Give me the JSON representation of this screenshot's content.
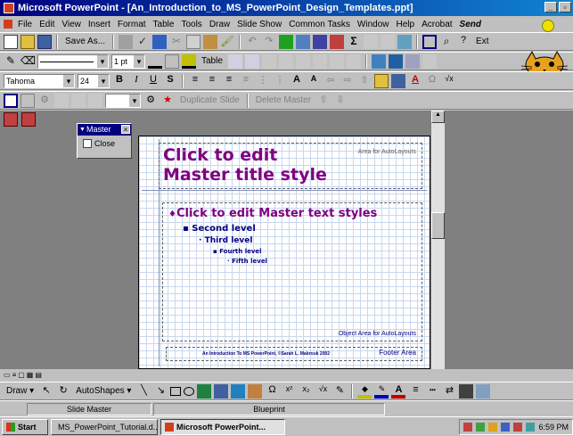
{
  "window": {
    "title": "Microsoft PowerPoint - [An_Introduction_to_MS_PowerPoint_Design_Templates.ppt]"
  },
  "menu": [
    "File",
    "Edit",
    "View",
    "Insert",
    "Format",
    "Table",
    "Tools",
    "Draw",
    "Slide Show",
    "Common Tasks",
    "Window",
    "Help",
    "Acrobat",
    "Send"
  ],
  "toolbar1": {
    "save_as": "Save As...",
    "table": "Table"
  },
  "toolbar2": {
    "line_weight": "1 pt",
    "table": "Table"
  },
  "formatting": {
    "font": "Tahoma",
    "size": "24"
  },
  "master_toolbar": {
    "duplicate_slide": "Duplicate Slide",
    "delete_master": "Delete Master"
  },
  "master_view": {
    "title": "Master",
    "close": "Close"
  },
  "slide": {
    "title": "Click to edit Master title style",
    "title_area_label": "Area for AutoLayouts",
    "body_title": "Click to edit Master text styles",
    "levels": [
      "Second level",
      "Third level",
      "Fourth level",
      "Fifth level"
    ],
    "object_area_label": "Object Area for AutoLayouts",
    "footer_text": "An Introduction To MS PowerPoint, ©Sarah L. Mabrouk 2002",
    "footer_area_label": "Footer Area"
  },
  "drawing": {
    "draw": "Draw",
    "autoshapes": "AutoShapes"
  },
  "status": {
    "view": "Slide Master",
    "design": "Blueprint"
  },
  "taskbar": {
    "start": "Start",
    "items": [
      "MS_PowerPoint_Tutorial.d...",
      "Microsoft PowerPoint..."
    ],
    "clock": "6:59 PM"
  }
}
